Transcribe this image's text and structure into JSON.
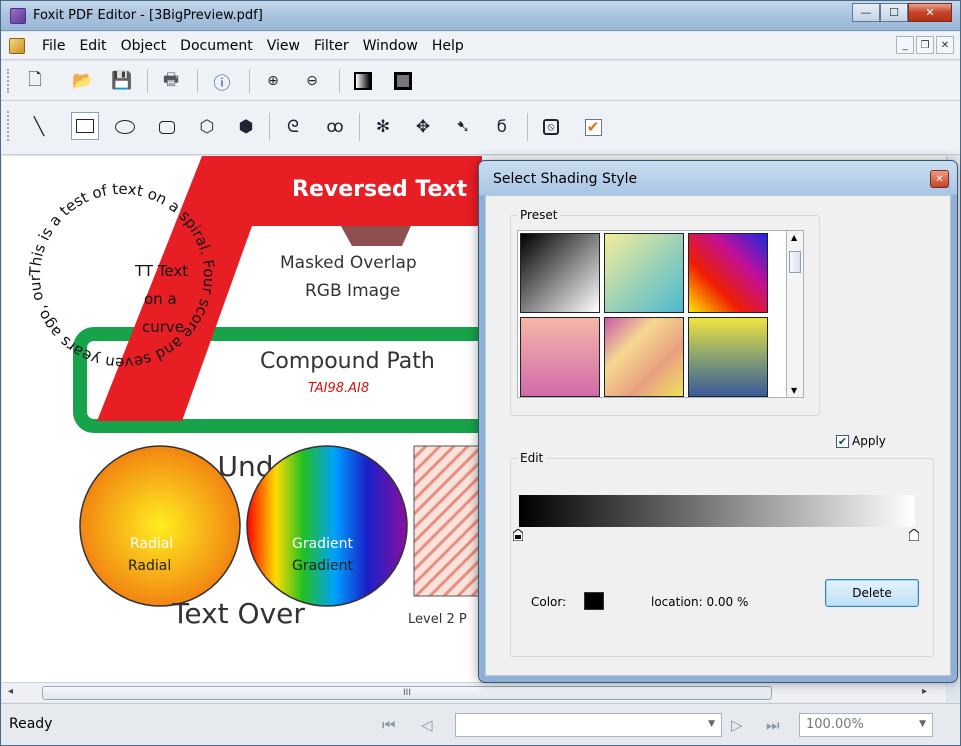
{
  "window": {
    "title": "Foxit PDF Editor - [3BigPreview.pdf]"
  },
  "menus": [
    "File",
    "Edit",
    "Object",
    "Document",
    "View",
    "Filter",
    "Window",
    "Help"
  ],
  "document": {
    "reversed_text": "Reversed Text",
    "masked_overlap": "Masked Overlap",
    "rgb_image": "RGB Image",
    "compound_path": "Compound Path",
    "compound_sub": "TAI98.AI8",
    "tt_text": [
      "TT Text",
      "on a",
      "curve"
    ],
    "spiral_text": "This is a test of text on a spiral. Four score and seven years ago, our forefathers brought forth ...",
    "text_under": "Text Under",
    "text_over": "Text Over",
    "radial": "Radial",
    "gradient": "Gradient",
    "level2": "Level 2 P"
  },
  "scroll": {
    "grip": "III"
  },
  "status": {
    "ready": "Ready",
    "zoom": "100.00%"
  },
  "dialog": {
    "title": "Select Shading Style",
    "preset_label": "Preset",
    "apply_label": "Apply",
    "apply_checked": true,
    "edit_label": "Edit",
    "color_label": "Color:",
    "location_label": "location: 0.00  %",
    "delete_label": "Delete",
    "colors": {
      "stop_color": "#000000",
      "accent": "#3c7fb1"
    }
  }
}
